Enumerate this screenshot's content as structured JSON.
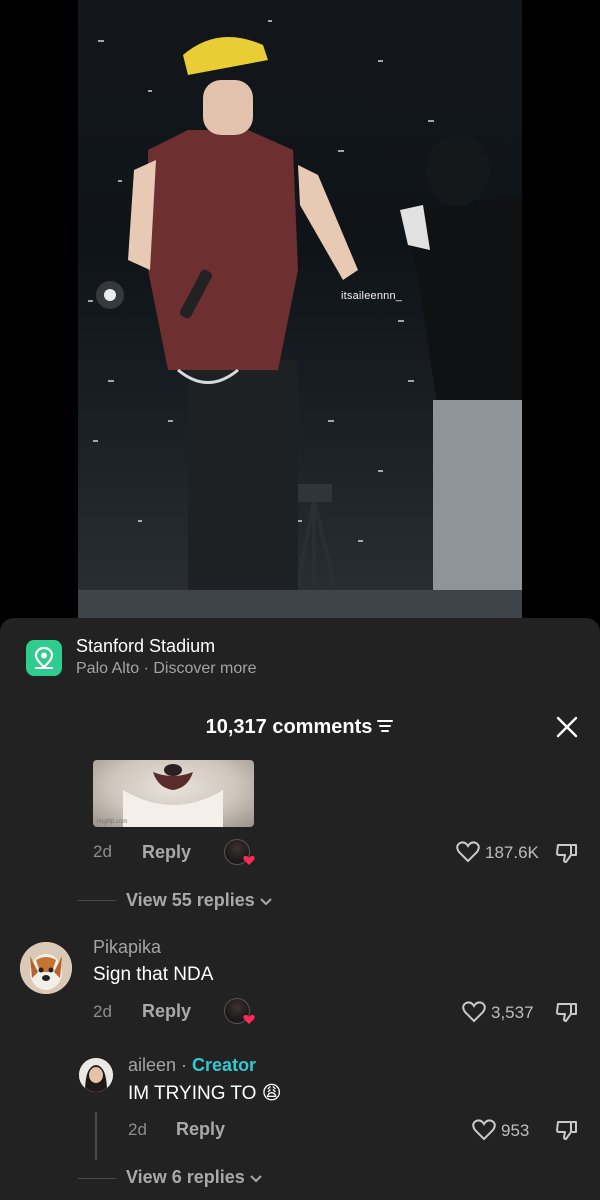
{
  "video": {
    "watermark": "itsaileennn_"
  },
  "location": {
    "title": "Stanford Stadium",
    "subtitle": "Palo Alto · Discover more",
    "icon": "map-pin-icon"
  },
  "comments_header": {
    "count_label": "10,317 comments"
  },
  "comment1": {
    "gif_watermark": "imgflip.com",
    "time": "2d",
    "reply_label": "Reply",
    "likes": "187.6K",
    "view_replies": "View 55 replies"
  },
  "comment2": {
    "username": "Pikapika",
    "text": "Sign that NDA",
    "time": "2d",
    "reply_label": "Reply",
    "likes": "3,537"
  },
  "reply1": {
    "username": "aileen",
    "separator": " · ",
    "creator_label": "Creator",
    "text": "IM TRYING TO 😩",
    "time": "2d",
    "reply_label": "Reply",
    "likes": "953",
    "view_replies": "View 6 replies"
  },
  "colors": {
    "sheet_bg": "#222222",
    "creator_accent": "#35c8d1",
    "location_icon_bg": "#2ecc8f",
    "heart_badge": "#ff2a55"
  }
}
